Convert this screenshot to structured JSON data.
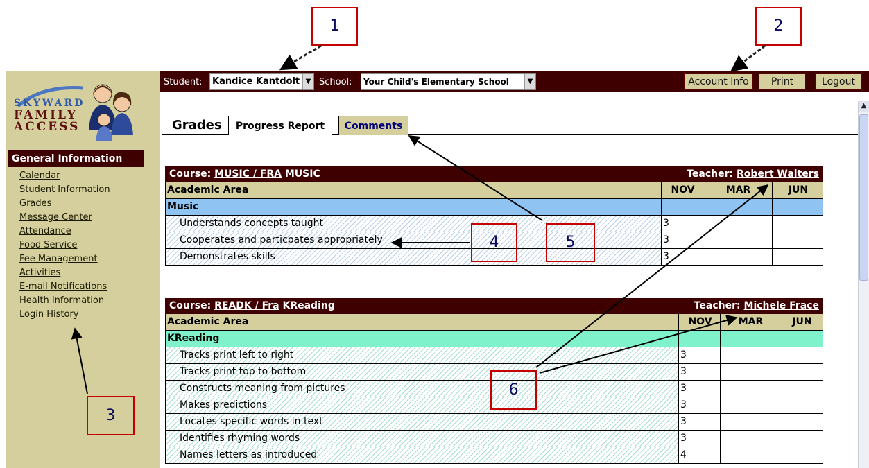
{
  "colors": {
    "maroon": "#3e0000",
    "khaki": "#d4cf9c",
    "music_subject": "#8ec3f2",
    "reading_subject": "#7ff2cc",
    "callout_border": "#c40000"
  },
  "logo": {
    "brand": "SKYWARD",
    "line1": "FAMILY",
    "line2": "ACCESS"
  },
  "sidebar": {
    "header": "General Information",
    "items": [
      {
        "label": "Calendar"
      },
      {
        "label": "Student Information"
      },
      {
        "label": "Grades"
      },
      {
        "label": "Message Center"
      },
      {
        "label": "Attendance"
      },
      {
        "label": "Food Service"
      },
      {
        "label": "Fee Management"
      },
      {
        "label": "Activities"
      },
      {
        "label": "E-mail Notifications"
      },
      {
        "label": "Health Information"
      },
      {
        "label": "Login History"
      }
    ]
  },
  "topbar": {
    "student_label": "Student:",
    "student_value": "Kandice Kantdolt",
    "school_label": "School:",
    "school_value": "Your Child's Elementary School",
    "buttons": {
      "account": "Account Info",
      "print": "Print",
      "logout": "Logout"
    }
  },
  "page": {
    "title": "Grades",
    "tabs": {
      "progress": "Progress Report",
      "comments": "Comments"
    }
  },
  "courses": [
    {
      "course_label": "Course:",
      "course_code": "MUSIC / FRA",
      "course_name": "MUSIC",
      "teacher_label": "Teacher:",
      "teacher": "Robert Walters",
      "area_header": "Academic Area",
      "periods": [
        "NOV",
        "MAR",
        "JUN"
      ],
      "subject": "Music",
      "skills": [
        {
          "name": "Understands concepts taught",
          "nov": "3",
          "mar": "",
          "jun": ""
        },
        {
          "name": "Cooperates and particpates appropriately",
          "nov": "3",
          "mar": "",
          "jun": ""
        },
        {
          "name": "Demonstrates skills",
          "nov": "3",
          "mar": "",
          "jun": ""
        }
      ]
    },
    {
      "course_label": "Course:",
      "course_code": "READK / Fra",
      "course_name": "KReading",
      "teacher_label": "Teacher:",
      "teacher": "Michele Frace",
      "area_header": "Academic Area",
      "periods": [
        "NOV",
        "MAR",
        "JUN"
      ],
      "subject": "KReading",
      "skills": [
        {
          "name": "Tracks print left to right",
          "nov": "3",
          "mar": "",
          "jun": ""
        },
        {
          "name": "Tracks print top to bottom",
          "nov": "3",
          "mar": "",
          "jun": ""
        },
        {
          "name": "Constructs meaning from pictures",
          "nov": "3",
          "mar": "",
          "jun": ""
        },
        {
          "name": "Makes predictions",
          "nov": "3",
          "mar": "",
          "jun": ""
        },
        {
          "name": "Locates specific words in text",
          "nov": "3",
          "mar": "",
          "jun": ""
        },
        {
          "name": "Identifies rhyming words",
          "nov": "3",
          "mar": "",
          "jun": ""
        },
        {
          "name": "Names letters as introduced",
          "nov": "4",
          "mar": "",
          "jun": ""
        }
      ]
    }
  ],
  "callouts": [
    "1",
    "2",
    "3",
    "4",
    "5",
    "6"
  ]
}
